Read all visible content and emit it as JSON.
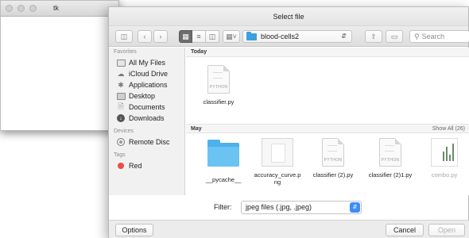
{
  "tk_window": {
    "title": "tk"
  },
  "dialog": {
    "title": "Select file",
    "path": "blood-cells2",
    "search_placeholder": "Search"
  },
  "sidebar": {
    "favorites_header": "Favorites",
    "favorites": [
      {
        "label": "All My Files",
        "icon": "all-files-icon"
      },
      {
        "label": "iCloud Drive",
        "icon": "cloud-icon"
      },
      {
        "label": "Applications",
        "icon": "applications-icon"
      },
      {
        "label": "Desktop",
        "icon": "desktop-icon"
      },
      {
        "label": "Documents",
        "icon": "documents-icon"
      },
      {
        "label": "Downloads",
        "icon": "downloads-icon"
      }
    ],
    "devices_header": "Devices",
    "devices": [
      {
        "label": "Remote Disc",
        "icon": "disc-icon"
      }
    ],
    "tags_header": "Tags",
    "tags": [
      {
        "label": "Red",
        "color": "#ef4b4b"
      }
    ]
  },
  "browser": {
    "today_header": "Today",
    "today_files": [
      {
        "name": "classifier.py",
        "kind": "PYTHON"
      }
    ],
    "may_header": "May",
    "show_all": "Show All (26)",
    "may_files": [
      {
        "name": "__pycache__",
        "kind": "folder"
      },
      {
        "name": "accuracy_curve.p\nng",
        "kind": "image"
      },
      {
        "name": "classifier (2).py",
        "kind": "PYTHON"
      },
      {
        "name": "classifier (2)1.py",
        "kind": "PYTHON"
      },
      {
        "name": "combo.py",
        "kind": "PYTHON"
      }
    ]
  },
  "filter": {
    "label": "Filter:",
    "value": "jpeg files (.jpg, .jpeg)"
  },
  "buttons": {
    "options": "Options",
    "cancel": "Cancel",
    "open": "Open"
  }
}
